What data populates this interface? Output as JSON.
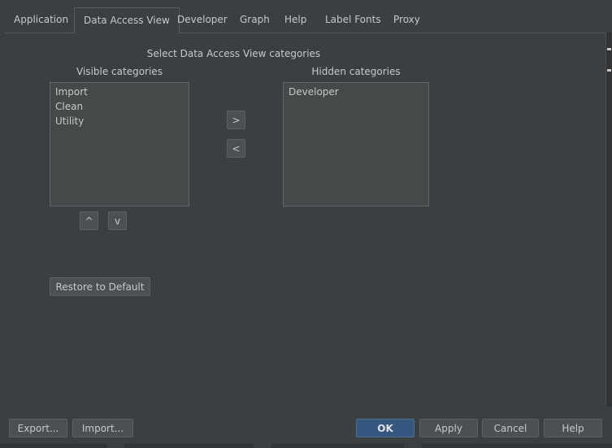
{
  "tabs": [
    {
      "label": "Application"
    },
    {
      "label": "Data Access View"
    },
    {
      "label": "Developer"
    },
    {
      "label": "Graph"
    },
    {
      "label": "Help"
    },
    {
      "label": "Label Fonts"
    },
    {
      "label": "Proxy"
    }
  ],
  "active_tab": "Data Access View",
  "section_title": "Select Data Access View categories",
  "visible": {
    "title": "Visible categories",
    "items": [
      "Import",
      "Clean",
      "Utility"
    ]
  },
  "hidden": {
    "title": "Hidden categories",
    "items": [
      "Developer"
    ]
  },
  "move_buttons": {
    "to_hidden": ">",
    "to_visible": "<"
  },
  "order_buttons": {
    "up": "^",
    "down": "v"
  },
  "restore_label": "Restore to Default",
  "footer": {
    "export": "Export...",
    "import": "Import...",
    "ok": "OK",
    "apply": "Apply",
    "cancel": "Cancel",
    "help": "Help"
  }
}
